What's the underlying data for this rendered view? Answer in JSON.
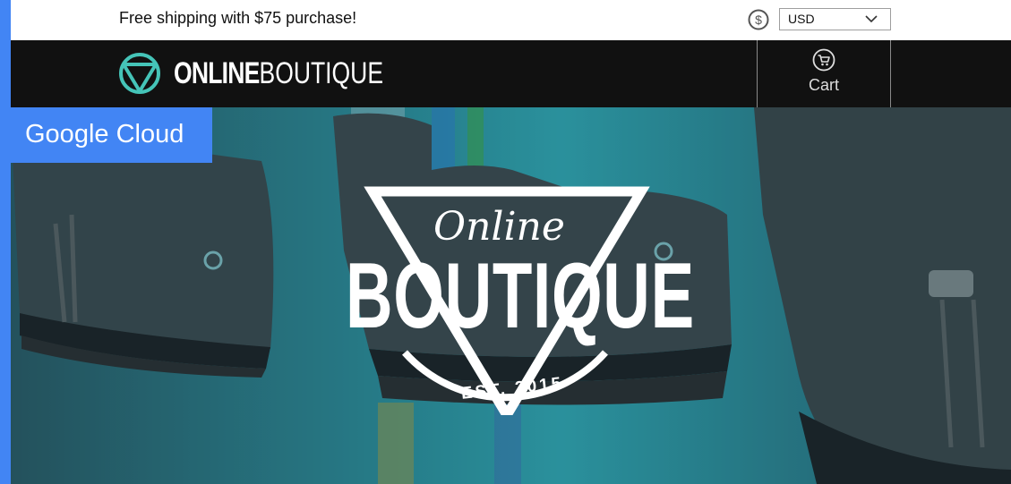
{
  "top_bar": {
    "promo": "Free shipping with $75 purchase!",
    "currency": {
      "icon": "dollar-circle-icon",
      "selected": "USD",
      "dropdown_icon": "chevron-down-icon"
    }
  },
  "header": {
    "logo": {
      "icon": "triangle-circle-logo-icon",
      "text_bold": "ONLINE",
      "text_light": "BOUTIQUE"
    },
    "cart": {
      "icon": "shopping-cart-icon",
      "label": "Cart"
    }
  },
  "badge": {
    "label": "Google Cloud"
  },
  "hero": {
    "script": "Online",
    "title": "BOUTIQUE",
    "est": "EST. 2015"
  },
  "colors": {
    "accent_blue": "#4285f4",
    "header_bg": "#111111",
    "logo_teal": "#45c4b8"
  }
}
